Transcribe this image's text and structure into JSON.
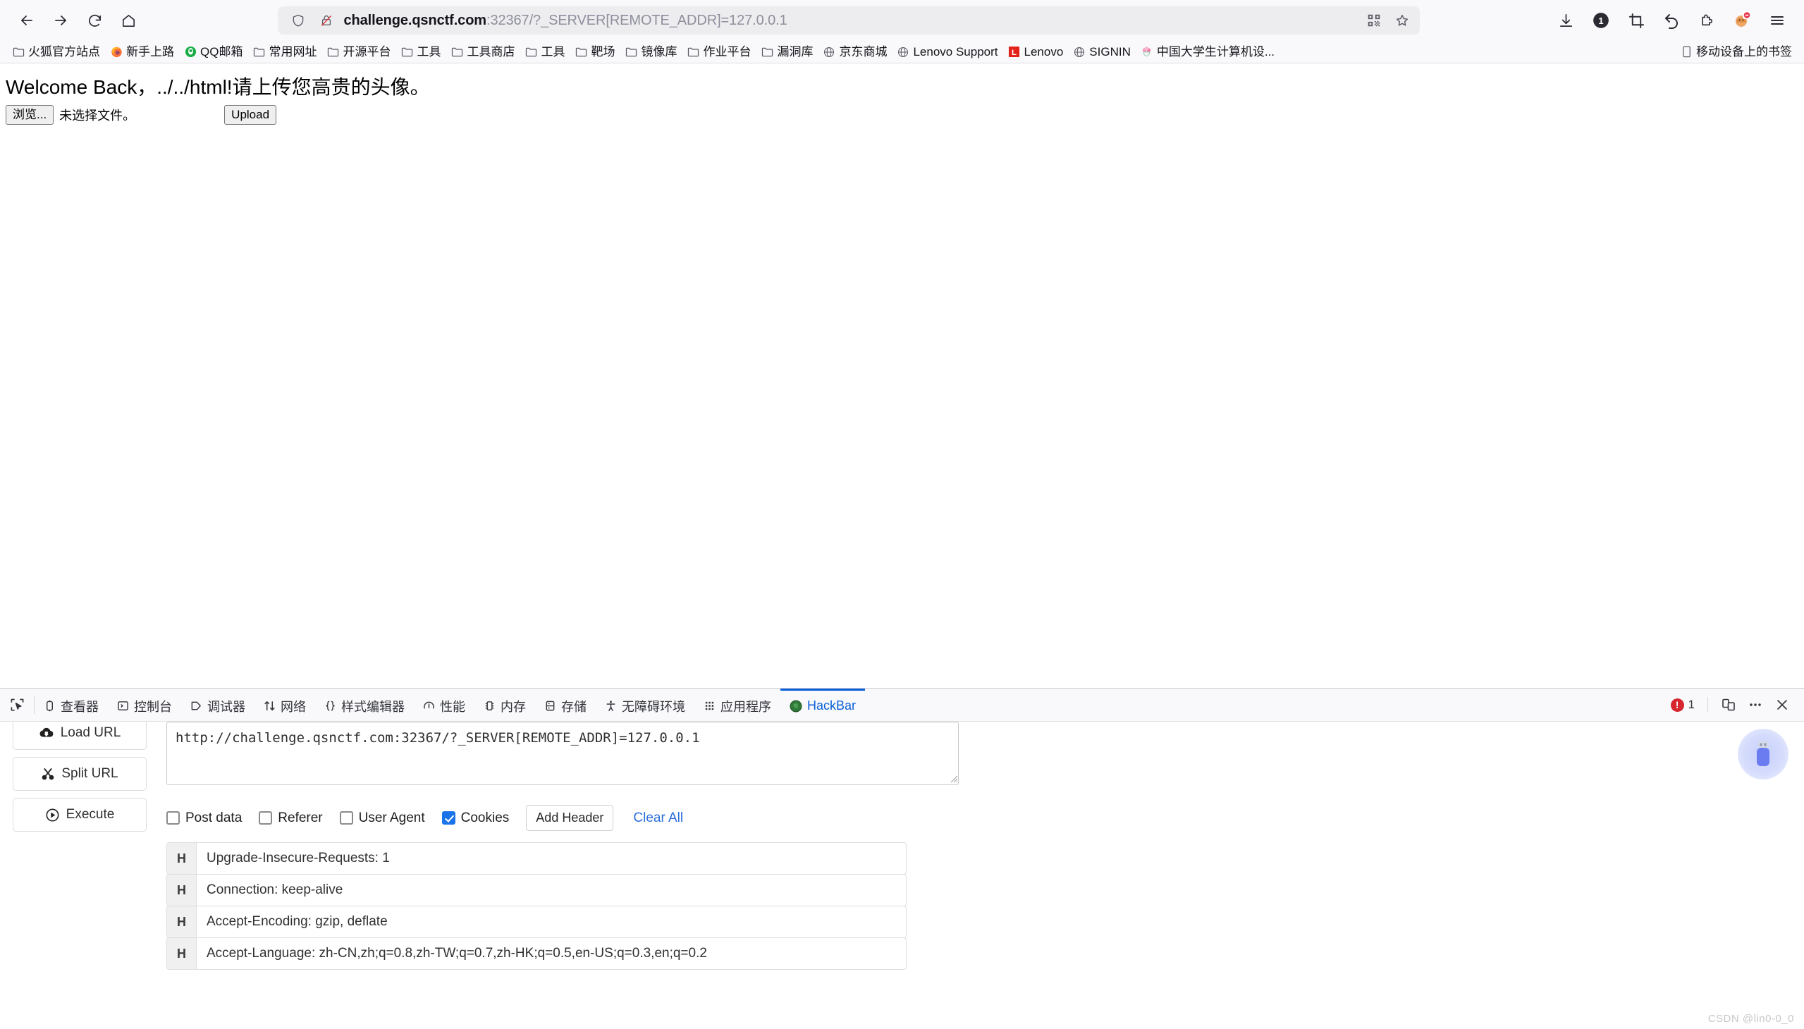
{
  "browser": {
    "nav": {
      "back": "back-arrow-icon",
      "forward": "forward-arrow-icon",
      "reload": "reload-icon",
      "home": "home-icon"
    },
    "url_bar": {
      "shield_icon": "shield-icon",
      "lock_broken_icon": "lock-crossed-icon",
      "host": "challenge.qsnctf.com",
      "rest": ":32367/?_SERVER[REMOTE_ADDR]=127.0.0.1",
      "full_url": "challenge.qsnctf.com:32367/?_SERVER[REMOTE_ADDR]=127.0.0.1",
      "qr_icon": "qr-code-icon",
      "bookmark_icon": "star-icon"
    },
    "toolbar_right": [
      {
        "name": "downloads-icon",
        "label": ""
      },
      {
        "name": "badge-counter-icon",
        "label": "1"
      },
      {
        "name": "screenshot-crop-icon",
        "label": ""
      },
      {
        "name": "undo-close-tab-icon",
        "label": ""
      },
      {
        "name": "extensions-puzzle-icon",
        "label": ""
      },
      {
        "name": "account-avatar-icon",
        "label": ""
      },
      {
        "name": "app-menu-icon",
        "label": ""
      }
    ]
  },
  "bookmarks": {
    "items": [
      {
        "label": "火狐官方站点",
        "icon": "folder-icon"
      },
      {
        "label": "新手上路",
        "icon": "firefox-icon"
      },
      {
        "label": "QQ邮箱",
        "icon": "qq-mail-icon"
      },
      {
        "label": "常用网址",
        "icon": "folder-icon"
      },
      {
        "label": "开源平台",
        "icon": "folder-icon"
      },
      {
        "label": "工具",
        "icon": "folder-icon"
      },
      {
        "label": "工具商店",
        "icon": "folder-icon"
      },
      {
        "label": "工具",
        "icon": "folder-icon"
      },
      {
        "label": "靶场",
        "icon": "folder-icon"
      },
      {
        "label": "镜像库",
        "icon": "folder-icon"
      },
      {
        "label": "作业平台",
        "icon": "folder-icon"
      },
      {
        "label": "漏洞库",
        "icon": "folder-icon"
      },
      {
        "label": "京东商城",
        "icon": "globe-icon"
      },
      {
        "label": "Lenovo Support",
        "icon": "globe-icon"
      },
      {
        "label": "Lenovo",
        "icon": "lenovo-icon"
      },
      {
        "label": "SIGNIN",
        "icon": "globe-icon"
      },
      {
        "label": "中国大学生计算机设...",
        "icon": "flower-icon"
      }
    ],
    "mobile_label": "移动设备上的书签",
    "mobile_icon": "mobile-device-icon"
  },
  "page": {
    "welcome_text": "Welcome Back，../../html!请上传您高贵的头像。",
    "browse_button": "浏览...",
    "file_status": "未选择文件。",
    "upload_button": "Upload"
  },
  "devtools": {
    "picker_icon": "element-picker-icon",
    "tabs": [
      {
        "label": "查看器",
        "icon": "inspector-icon",
        "active": false
      },
      {
        "label": "控制台",
        "icon": "console-icon",
        "active": false
      },
      {
        "label": "调试器",
        "icon": "debugger-icon",
        "active": false
      },
      {
        "label": "网络",
        "icon": "network-icon",
        "active": false
      },
      {
        "label": "样式编辑器",
        "icon": "style-editor-icon",
        "active": false
      },
      {
        "label": "性能",
        "icon": "performance-icon",
        "active": false
      },
      {
        "label": "内存",
        "icon": "memory-icon",
        "active": false
      },
      {
        "label": "存储",
        "icon": "storage-icon",
        "active": false
      },
      {
        "label": "无障碍环境",
        "icon": "accessibility-icon",
        "active": false
      },
      {
        "label": "应用程序",
        "icon": "application-icon",
        "active": false
      },
      {
        "label": "HackBar",
        "icon": "hackbar-icon",
        "active": true
      }
    ],
    "error_count": "1",
    "error_icon": "error-badge-icon",
    "responsive_icon": "responsive-design-mode-icon",
    "meatball_icon": "more-options-icon",
    "close_icon": "close-icon"
  },
  "hackbar": {
    "buttons": [
      {
        "label": "Load URL",
        "icon": "cloud-download-icon"
      },
      {
        "label": "Split URL",
        "icon": "scissors-icon"
      },
      {
        "label": "Execute",
        "icon": "play-circle-icon"
      }
    ],
    "url_value": "http://challenge.qsnctf.com:32367/?_SERVER[REMOTE_ADDR]=127.0.0.1",
    "options": [
      {
        "label": "Post data",
        "checked": false
      },
      {
        "label": "Referer",
        "checked": false
      },
      {
        "label": "User Agent",
        "checked": false
      },
      {
        "label": "Cookies",
        "checked": true
      }
    ],
    "add_header_label": "Add Header",
    "clear_all_label": "Clear All",
    "header_tag": "H",
    "headers": [
      "Upgrade-Insecure-Requests: 1",
      "Connection: keep-alive",
      "Accept-Encoding: gzip, deflate",
      "Accept-Language: zh-CN,zh;q=0.8,zh-TW;q=0.7,zh-HK;q=0.5,en-US;q=0.3,en;q=0.2"
    ],
    "fab_icon": "usb-drive-icon"
  },
  "watermark": "CSDN @lin0-0_0",
  "colors": {
    "accent_blue": "#0a60d8",
    "link_blue": "#2a6fdb",
    "checkbox_blue": "#1a73e8",
    "error_red": "#d7262f",
    "chrome_bg": "#f9f9fb"
  }
}
